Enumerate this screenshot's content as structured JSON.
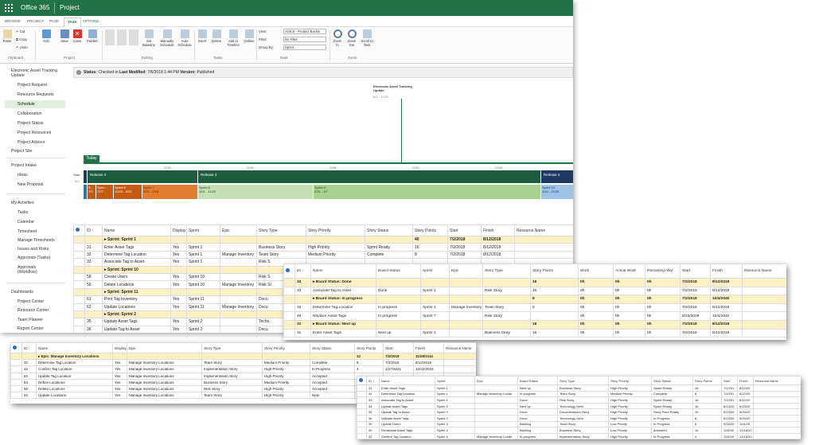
{
  "app": {
    "suite": "Office 365",
    "name": "Project"
  },
  "tabs": [
    "BROWSE",
    "PROJECT",
    "PAGE",
    "TASK",
    "OPTIONS"
  ],
  "active_tab": "TASK",
  "ribbon": {
    "clipboard": {
      "paste": "Paste",
      "cut": "Cut",
      "copy": "Copy",
      "undo": "Undo",
      "label": "Clipboard"
    },
    "project": {
      "edit": "Edit",
      "save": "Save",
      "close": "Close",
      "publish": "Publish",
      "label": "Project"
    },
    "editing": {
      "set_baseline": "Set Baseline",
      "manually": "Manually Schedule",
      "auto": "Auto Schedule",
      "label": "Editing"
    },
    "tasks": {
      "insert": "Insert",
      "delete": "Delete",
      "add_timeline": "Add to Timeline",
      "outline": "Outline",
      "label": "Tasks"
    },
    "data": {
      "view_label": "View:",
      "view_value": "AGILE - Product Backlo",
      "filter_label": "Filter:",
      "filter_value": "No Filter",
      "group_label": "Group By:",
      "group_value": "Sprint",
      "label": "Data"
    },
    "zoom": {
      "zoom_in": "Zoom In",
      "zoom_out": "Zoom Out",
      "scroll": "Scroll to Task",
      "label": "Zoom"
    }
  },
  "leftnav": [
    "Electronic Asset Tracking Update",
    "Project Request",
    "Resource Requests",
    "Schedule",
    "Collaboration",
    "Project Status",
    "Project Resources",
    "Project Advisor",
    "Project Site",
    "Project Intake",
    "Ideas",
    "New Proposal",
    "My Activities",
    "Tasks",
    "Calendar",
    "Timesheet",
    "Manage Timesheets",
    "Issues and Risks",
    "Approvals (Tasks)",
    "Approvals (Workflow)",
    "Dashboards",
    "Project Center",
    "Resource Center",
    "Team Planner",
    "Report Center"
  ],
  "status": {
    "label": "Status:",
    "value": "Checked-in",
    "modified_label": "Last Modified:",
    "modified_value": "7/6/2018 1:44 PM",
    "version_label": "Version:",
    "version_value": "Published"
  },
  "timeline": {
    "milestone_title": "Electronic Asset Tracking Update",
    "milestone_dates": "6/1 - 11/20",
    "today": "Today",
    "years": [
      "2034",
      "2050",
      "2066",
      "2082",
      "2098"
    ],
    "releases": [
      {
        "label": "Release 2"
      },
      {
        "label": "Release 3"
      },
      {
        "label": "Release 4"
      }
    ],
    "sprints": [
      {
        "label": "S...",
        "dates": "7/2"
      },
      {
        "label": "Sprin...",
        "dates": "7/27 -"
      },
      {
        "label": "Sprint 6",
        "dates": "12/26 - 8/22"
      },
      {
        "label": "Sprint 7",
        "dates": "1/21 - 2/18"
      },
      {
        "label": "Sprint 8",
        "dates": "10/1 - 11/20"
      },
      {
        "label": "Sprint 9",
        "dates": "2/11 - 1/7"
      },
      {
        "label": "Sprint 10",
        "dates": "1/10 - 11/25"
      }
    ],
    "start_label": "Start",
    "start_date": "6/1"
  },
  "main_grid": {
    "headers": [
      "",
      "ID ↑",
      "Name",
      "Display",
      "Sprint",
      "Epic",
      "Story Type",
      "Story Priority",
      "Story Status",
      "Story Points",
      "Start",
      "Finish",
      "Resource Name"
    ],
    "rows": [
      {
        "type": "sum",
        "id": "",
        "name": "▸ Sprint: Sprint 1",
        "disp": "",
        "sprint": "",
        "epic": "",
        "stype": "",
        "prio": "",
        "status": "",
        "pts": "40",
        "start": "7/2/2018",
        "finish": "8/12/2018"
      },
      {
        "type": "norm",
        "id": "31",
        "name": "Enter Asset Tags",
        "disp": "Yes",
        "sprint": "Sprint 1",
        "epic": "",
        "stype": "Business Story",
        "prio": "High Priority",
        "status": "Sprint Ready",
        "pts": "16",
        "start": "7/2/2018",
        "finish": "8/12/2018"
      },
      {
        "type": "norm",
        "id": "32",
        "name": "Determine Tag Location",
        "disp": "Yes",
        "sprint": "Sprint 1",
        "epic": "Manage Inventory",
        "stype": "Team Story",
        "prio": "Medium Priority",
        "status": "Complete",
        "pts": "8",
        "start": "7/2/2018",
        "finish": "8/12/2018"
      },
      {
        "type": "norm",
        "id": "33",
        "name": "Associate Tag to Asset",
        "disp": "Yes",
        "sprint": "Sprint 1",
        "epic": "",
        "stype": "Risk S",
        "prio": "",
        "status": "",
        "pts": "",
        "start": "",
        "finish": ""
      },
      {
        "type": "sum",
        "id": "",
        "name": "▸ Sprint: Sprint 10",
        "disp": "",
        "sprint": "",
        "epic": "",
        "stype": "",
        "prio": "",
        "status": "",
        "pts": "",
        "start": "",
        "finish": ""
      },
      {
        "type": "norm",
        "id": "58",
        "name": "Create Users",
        "disp": "Yes",
        "sprint": "Sprint 10",
        "epic": "",
        "stype": "Risk S",
        "prio": "",
        "status": "",
        "pts": "",
        "start": "",
        "finish": ""
      },
      {
        "type": "norm",
        "id": "59",
        "name": "Delete Locations",
        "disp": "Yes",
        "sprint": "Sprint 10",
        "epic": "Manage Inventory",
        "stype": "Risk St",
        "prio": "",
        "status": "",
        "pts": "",
        "start": "",
        "finish": ""
      },
      {
        "type": "sum",
        "id": "",
        "name": "▸ Sprint: Sprint 11",
        "disp": "",
        "sprint": "",
        "epic": "",
        "stype": "",
        "prio": "",
        "status": "",
        "pts": "",
        "start": "",
        "finish": ""
      },
      {
        "type": "norm",
        "id": "61",
        "name": "Print Tag Inventory",
        "disp": "Yes",
        "sprint": "Sprint 11",
        "epic": "",
        "stype": "Docu",
        "prio": "",
        "status": "",
        "pts": "",
        "start": "",
        "finish": ""
      },
      {
        "type": "norm",
        "id": "62",
        "name": "Update Locations",
        "disp": "Yes",
        "sprint": "Sprint 11",
        "epic": "Manage Inventory",
        "stype": "Docu",
        "prio": "",
        "status": "",
        "pts": "",
        "start": "",
        "finish": ""
      },
      {
        "type": "sum",
        "id": "",
        "name": "▸ Sprint: Sprint 2",
        "disp": "",
        "sprint": "",
        "epic": "",
        "stype": "",
        "prio": "",
        "status": "",
        "pts": "",
        "start": "",
        "finish": ""
      },
      {
        "type": "norm",
        "id": "35",
        "name": "Update Asset Tags",
        "disp": "Yes",
        "sprint": "Sprint 2",
        "epic": "",
        "stype": "Techn",
        "prio": "",
        "status": "",
        "pts": "",
        "start": "",
        "finish": ""
      },
      {
        "type": "norm",
        "id": "36",
        "name": "Update Tag to Asset",
        "disp": "Yes",
        "sprint": "Sprint 2",
        "epic": "",
        "stype": "Docu",
        "prio": "",
        "status": "",
        "pts": "",
        "start": "",
        "finish": ""
      }
    ]
  },
  "board_panel": {
    "headers": [
      "",
      "ID ↑",
      "Name",
      "Board Status",
      "Sprint",
      "Epic",
      "Story Type",
      "Story Points",
      "Work",
      "Actual Work",
      "Remaining Wor",
      "Start",
      "Finish",
      "Resource Name"
    ],
    "rows": [
      {
        "type": "sum",
        "id": "33",
        "name": "▸ Board Status: Done",
        "bs": "",
        "sprint": "",
        "epic": "",
        "stype": "",
        "pts": "16",
        "work": "0h",
        "aw": "0h",
        "rw": "0h",
        "start": "7/2/2018",
        "finish": "8/12/2018"
      },
      {
        "type": "norm",
        "id": "33",
        "name": "Associate Tag to Asset",
        "bs": "Done",
        "sprint": "Sprint 1",
        "epic": "",
        "stype": "Risk Story",
        "pts": "16",
        "work": "0h",
        "aw": "0h",
        "rw": "0h",
        "start": "7/2/2018",
        "finish": "8/12/2018"
      },
      {
        "type": "sum",
        "id": "",
        "name": "▸ Board Status: In progress",
        "bs": "",
        "sprint": "",
        "epic": "",
        "stype": "",
        "pts": "8",
        "work": "0h",
        "aw": "0h",
        "rw": "0h",
        "start": "7/2/2018",
        "finish": "10/4/2040"
      },
      {
        "type": "norm",
        "id": "32",
        "name": "Determine Tag Location",
        "bs": "In progress",
        "sprint": "Sprint 1",
        "epic": "Manage Inventory",
        "stype": "Team Story",
        "pts": "8",
        "work": "0h",
        "aw": "0h",
        "rw": "0h",
        "start": "7/2/2018",
        "finish": "8/12/2018"
      },
      {
        "type": "norm",
        "id": "49",
        "name": "Replace Asset Tags",
        "bs": "In progress",
        "sprint": "Sprint 7",
        "epic": "",
        "stype": "Risk Story",
        "pts": "",
        "work": "0h",
        "aw": "0h",
        "rw": "0h",
        "start": "8/23/2029",
        "finish": "10/4/2040"
      },
      {
        "type": "sum",
        "id": "31",
        "name": "▸ Board Status: Next up",
        "bs": "",
        "sprint": "",
        "epic": "",
        "stype": "",
        "pts": "16",
        "work": "0h",
        "aw": "0h",
        "rw": "0h",
        "start": "7/2/2018",
        "finish": "8/12/2018"
      },
      {
        "type": "norm",
        "id": "31",
        "name": "Enter Asset Tags",
        "bs": "Next up",
        "sprint": "Sprint 1",
        "epic": "",
        "stype": "Business Story",
        "pts": "16",
        "work": "0h",
        "aw": "0h",
        "rw": "0h",
        "start": "7/2/2018",
        "finish": "8/12/2018"
      }
    ]
  },
  "epic_panel": {
    "headers": [
      "",
      "ID ↑",
      "Name",
      "Display",
      "Epic",
      "Story Type",
      "Story Priority",
      "Story Status",
      "Story Points",
      "Start",
      "Finish",
      "Resource Name"
    ],
    "rows": [
      {
        "type": "sum",
        "id": "",
        "name": "▸ Epic: Manage Inventory Locations",
        "disp": "",
        "epic": "",
        "stype": "",
        "prio": "",
        "status": "",
        "pts": "12",
        "start": "7/2/2018",
        "finish": "11/28/2141"
      },
      {
        "type": "norm",
        "id": "32",
        "name": "Determine Tag Location",
        "disp": "Yes",
        "epic": "Manage Inventory Locations",
        "stype": "Team Story",
        "prio": "Medium Priority",
        "status": "Complete",
        "pts": "8",
        "start": "7/2/2018",
        "finish": "8/12/2018"
      },
      {
        "type": "norm",
        "id": "42",
        "name": "Confirm Tag Location",
        "disp": "Yes",
        "epic": "Manage Inventory Locations",
        "stype": "Implementation Story",
        "prio": "High Priority",
        "status": "In Progress",
        "pts": "4",
        "start": "1/27/2021",
        "finish": "12/22/2023"
      },
      {
        "type": "norm",
        "id": "52",
        "name": "Update Tag Location",
        "disp": "Yes",
        "epic": "Manage Inventory Locations",
        "stype": "Implementation Story",
        "prio": "High Priority",
        "status": "Accepted",
        "pts": "",
        "start": "",
        "finish": ""
      },
      {
        "type": "norm",
        "id": "53",
        "name": "Define Locations",
        "disp": "Yes",
        "epic": "Manage Inventory Locations",
        "stype": "Business Story",
        "prio": "Medium Priority",
        "status": "Accepted",
        "pts": "",
        "start": "",
        "finish": ""
      },
      {
        "type": "norm",
        "id": "56",
        "name": "Delete Locations",
        "disp": "Yes",
        "epic": "Manage Inventory Locations",
        "stype": "Risk Story",
        "prio": "High Priority",
        "status": "Accepted",
        "pts": "",
        "start": "",
        "finish": ""
      },
      {
        "type": "norm",
        "id": "62",
        "name": "Update Locations",
        "disp": "Yes",
        "epic": "Manage Inventory Locations",
        "stype": "Team Story",
        "prio": "High Priority",
        "status": "New",
        "pts": "",
        "start": "",
        "finish": ""
      }
    ]
  },
  "backlog_panel": {
    "headers": [
      "",
      "ID ↑",
      "Name",
      "Sprint",
      "Epic",
      "Board Status",
      "Story Type",
      "Story Priority",
      "Story Status",
      "Story Points",
      "Start",
      "Finish",
      "Resource Name"
    ],
    "rows": [
      {
        "id": "31",
        "name": "Enter Asset Tags",
        "sprint": "Sprint 1",
        "epic": "",
        "bs": "Next up",
        "stype": "Business Story",
        "prio": "High Priority",
        "status": "Sprint Ready",
        "pts": "16",
        "start": "7/2/201",
        "finish": "8/12/20"
      },
      {
        "id": "32",
        "name": "Determine Tag Location",
        "sprint": "Sprint 1",
        "epic": "Manage Inventory Locati",
        "bs": "In progress",
        "stype": "Team Story",
        "prio": "Medium Priority",
        "status": "Complete",
        "pts": "8",
        "start": "7/2/201",
        "finish": "8/12/20"
      },
      {
        "id": "33",
        "name": "Associate Tag to Asset",
        "sprint": "Sprint 1",
        "epic": "",
        "bs": "Done",
        "stype": "Risk Story",
        "prio": "High Priority",
        "status": "Sprint Ready",
        "pts": "16",
        "start": "7/2/201",
        "finish": "8/12/20"
      },
      {
        "id": "34",
        "name": "Update Asset Tags",
        "sprint": "Sprint 2",
        "epic": "",
        "bs": "Next up",
        "stype": "Technology Debt",
        "prio": "High Priority",
        "status": "Sprint Ready",
        "pts": "16",
        "start": "8/13/20",
        "finish": "9/23/20"
      },
      {
        "id": "35",
        "name": "Update Tag to Asset",
        "sprint": "Sprint 2",
        "epic": "",
        "bs": "Done",
        "stype": "Documentation Story",
        "prio": "High Priority",
        "status": "Story Point Ready",
        "pts": "16",
        "start": "8/13/20",
        "finish": "9/23/20"
      },
      {
        "id": "36",
        "name": "Validate Asset Tags",
        "sprint": "Sprint 2",
        "epic": "",
        "bs": "Done",
        "stype": "Technology Debt",
        "prio": "High Priority",
        "status": "In Progress",
        "pts": "8",
        "start": "8/13/20",
        "finish": "9/23/20"
      },
      {
        "id": "39",
        "name": "Update Users",
        "sprint": "Sprint 3",
        "epic": "",
        "bs": "Backlog",
        "stype": "Team Story",
        "prio": "Low Priority",
        "status": "In Progress",
        "pts": "8",
        "start": "9/24/20",
        "finish": "11/4/20"
      },
      {
        "id": "40",
        "name": "Revalidate Asset Tags",
        "sprint": "Sprint 4",
        "epic": "",
        "bs": "Backlog",
        "stype": "Business Story",
        "prio": "Low Priority",
        "status": "Accepted",
        "pts": "16",
        "start": "11/5/20",
        "finish": "12/16/20"
      },
      {
        "id": "42",
        "name": "Confirm Tag Location",
        "sprint": "Sprint 4",
        "epic": "Manage Inventory Locati",
        "bs": "In progress",
        "stype": "Implementation Story",
        "prio": "High Priority",
        "status": "In Progress",
        "pts": "4",
        "start": "11/5/20",
        "finish": "12/16/20"
      }
    ]
  },
  "colors": {
    "brand": "#217346",
    "summary_row": "#fdf1c3",
    "release_dark": "#1d5c3f",
    "sprint_orange": "#c55a11",
    "sprint_green": "#a9d18e",
    "sprint_blue": "#9dc3e6"
  }
}
